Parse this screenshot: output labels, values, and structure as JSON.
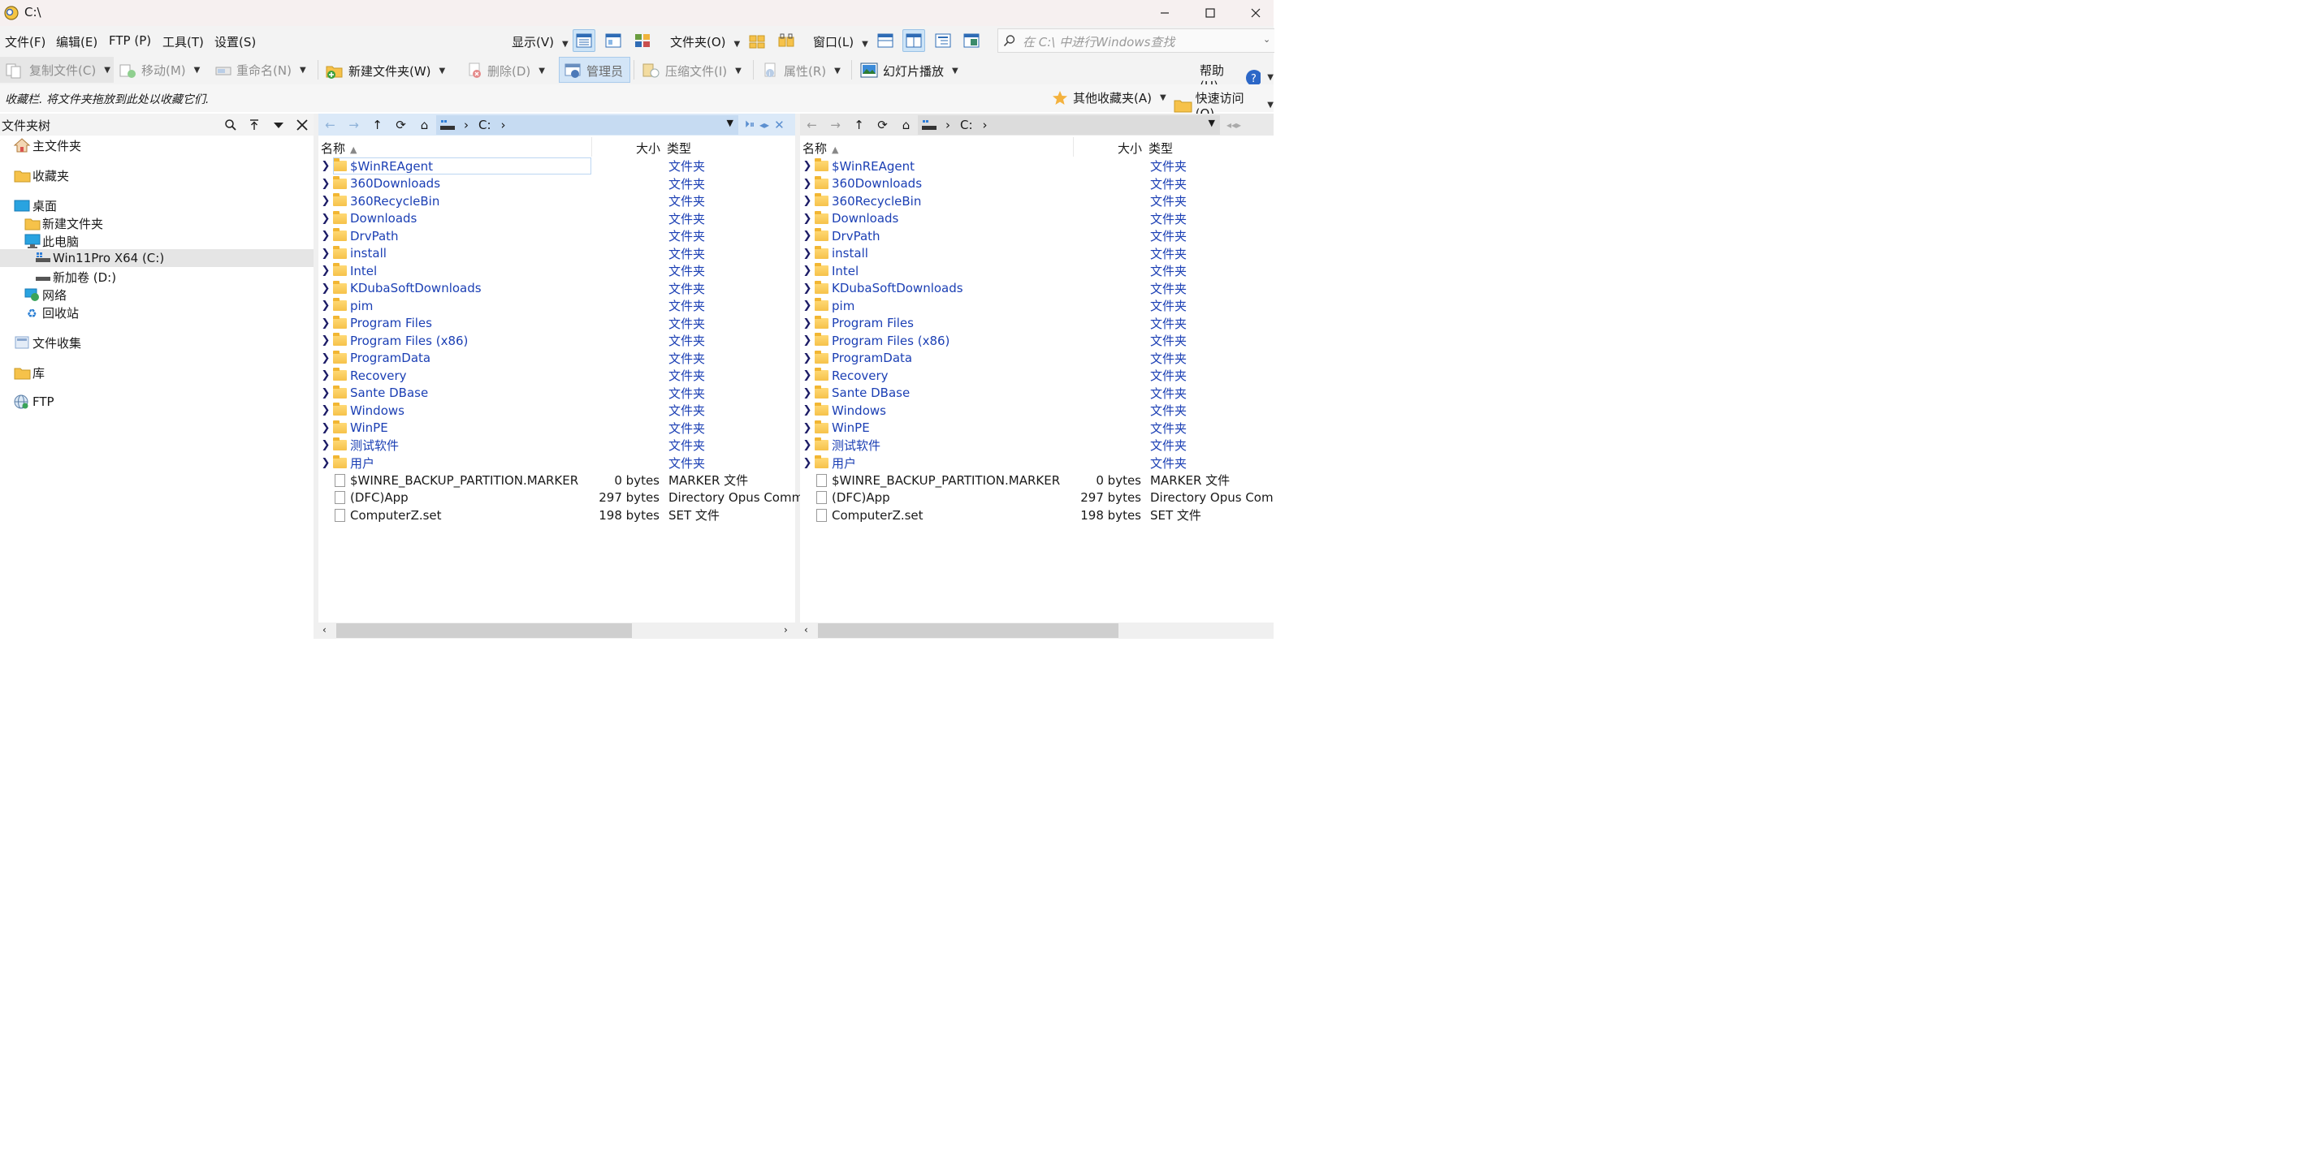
{
  "window": {
    "title": "C:\\"
  },
  "menu": {
    "items": [
      "文件(F)",
      "编辑(E)",
      "FTP (P)",
      "工具(T)",
      "设置(S)"
    ],
    "display": "显示(V)",
    "folder": "文件夹(O)",
    "window": "窗口(L)",
    "search_placeholder": "在 C:\\ 中进行Windows查找"
  },
  "toolbar": {
    "copy": "复制文件(C)",
    "move": "移动(M)",
    "rename": "重命名(N)",
    "new_folder": "新建文件夹(W)",
    "delete": "删除(D)",
    "admin": "管理员",
    "compress": "压缩文件(I)",
    "properties": "属性(R)",
    "slideshow": "幻灯片播放",
    "help": "帮助(H)"
  },
  "favbar": {
    "hint": "收藏栏. 将文件夹拖放到此处以收藏它们.",
    "other": "其他收藏夹(A)",
    "quick": "快速访问(Q)"
  },
  "tree": {
    "title": "文件夹树",
    "items": [
      "主文件夹",
      "收藏夹",
      "桌面",
      "新建文件夹",
      "此电脑",
      "Win11Pro X64 (C:)",
      "新加卷 (D:)",
      "网络",
      "回收站",
      "文件收集",
      "库",
      "FTP"
    ]
  },
  "pane": {
    "path": "C:",
    "col_name": "名称",
    "col_size": "大小",
    "col_type": "类型",
    "folder_type": "文件夹"
  },
  "folders": [
    "$WinREAgent",
    "360Downloads",
    "360RecycleBin",
    "Downloads",
    "DrvPath",
    "install",
    "Intel",
    "KDubaSoftDownloads",
    "pim",
    "Program Files",
    "Program Files (x86)",
    "ProgramData",
    "Recovery",
    "Sante DBase",
    "Windows",
    "WinPE",
    "测试软件",
    "用户"
  ],
  "files": [
    {
      "name": "$WINRE_BACKUP_PARTITION.MARKER",
      "size": "0 bytes",
      "type": "MARKER 文件"
    },
    {
      "name": "(DFC)App",
      "size": "297 bytes",
      "type": "Directory Opus Comm"
    },
    {
      "name": "ComputerZ.set",
      "size": "198 bytes",
      "type": "SET 文件"
    }
  ],
  "colors": {
    "accent": "#1b3fb4",
    "pane_nav_active": "#dbe9f8",
    "pane_nav_inactive": "#e9e9e9"
  }
}
